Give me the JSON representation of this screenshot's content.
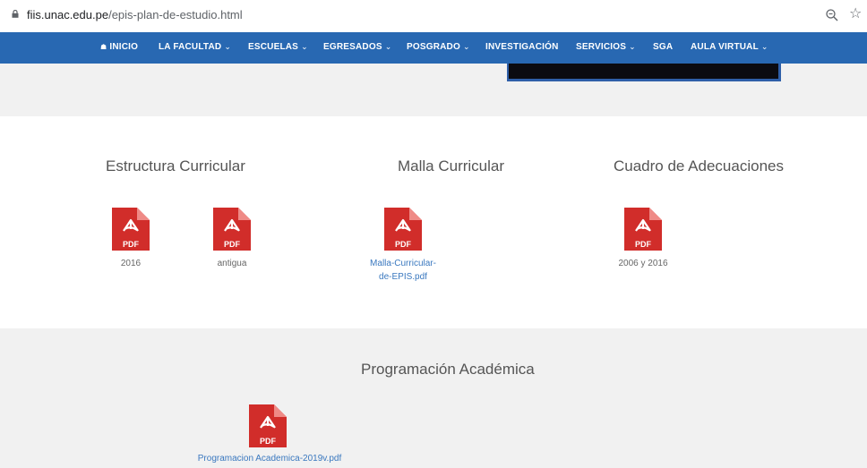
{
  "browser": {
    "url_domain": "fiis.unac.edu.pe",
    "url_path": "/epis-plan-de-estudio.html",
    "zoom_icon": "zoom-icon",
    "bookmark_icon": "star-icon"
  },
  "nav": {
    "items": [
      {
        "label": "INICIO",
        "icon": "home-icon"
      },
      {
        "label": "LA FACULTAD",
        "dropdown": true
      },
      {
        "label": "ESCUELAS",
        "dropdown": true
      },
      {
        "label": "EGRESADOS",
        "dropdown": true
      },
      {
        "label": "POSGRADO",
        "dropdown": true
      },
      {
        "label": "INVESTIGACIÓN"
      },
      {
        "label": "SERVICIOS",
        "dropdown": true
      },
      {
        "label": "SGA"
      },
      {
        "label": "AULA VIRTUAL",
        "dropdown": true
      }
    ],
    "chevron": "⌄",
    "home_glyph": "☗"
  },
  "sections": {
    "estructura": {
      "title": "Estructura Curricular",
      "files": [
        {
          "caption": "2016"
        },
        {
          "caption": "antigua"
        }
      ]
    },
    "malla": {
      "title": "Malla Curricular",
      "files": [
        {
          "caption_line1": "Malla-Curricular-",
          "caption_line2": "de-EPIS.pdf"
        }
      ]
    },
    "cuadro": {
      "title": "Cuadro de Adecuaciones",
      "files": [
        {
          "caption": "2006 y 2016"
        }
      ]
    },
    "programacion": {
      "title": "Programación Académica",
      "files": [
        {
          "caption": "Programacion Academica-2019v.pdf"
        }
      ]
    }
  },
  "pdf_label": "PDF",
  "colors": {
    "nav": "#2868b2",
    "pdf_red": "#d12d2a",
    "link": "#3a78bf",
    "band": "#f1f1f1"
  }
}
